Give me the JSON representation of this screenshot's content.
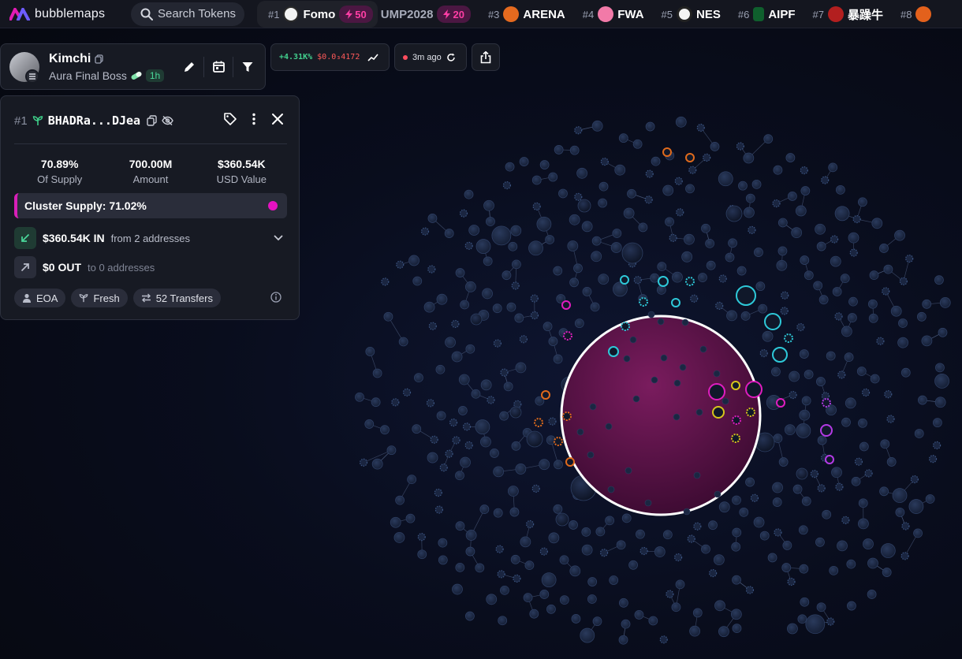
{
  "app": {
    "logo_text": "bubblemaps"
  },
  "search": {
    "label": "Search Tokens"
  },
  "trending": [
    {
      "rank": "#1",
      "name": "Fomo",
      "boost": "50"
    },
    {
      "rank": "",
      "name": "UMP2028",
      "boost": "20"
    },
    {
      "rank": "#3",
      "name": "ARENA"
    },
    {
      "rank": "#4",
      "name": "FWA"
    },
    {
      "rank": "#5",
      "name": "NES"
    },
    {
      "rank": "#6",
      "name": "AIPF"
    },
    {
      "rank": "#7",
      "name": "暴躁牛"
    },
    {
      "rank": "#8",
      "name": ""
    }
  ],
  "user": {
    "name": "Kimchi",
    "title": "Aura Final Boss",
    "age": "1h"
  },
  "price_pill": {
    "change": "+4.31K%",
    "price": "$0.0₃4172"
  },
  "time_pill": {
    "label": "3m ago"
  },
  "detail": {
    "rank": "#1",
    "address": "BHADRa...DJea",
    "stats": [
      {
        "value": "70.89%",
        "label": "Of Supply"
      },
      {
        "value": "700.00M",
        "label": "Amount"
      },
      {
        "value": "$360.54K",
        "label": "USD Value"
      }
    ],
    "cluster": "Cluster Supply: 71.02%",
    "inflow": {
      "amount": "$360.54K IN",
      "sub": "from 2 addresses"
    },
    "outflow": {
      "amount": "$0 OUT",
      "sub": "to 0 addresses"
    },
    "chips": [
      "EOA",
      "Fresh",
      "52 Transfers"
    ]
  },
  "colors": {
    "accent": "#e612c2",
    "cluster_bubble": "#6e1652",
    "cyan": "#2ec9d9",
    "magenta": "#e01dc0",
    "yellow": "#d6c51c",
    "orange": "#e06a1c",
    "purple": "#b43ae6",
    "node": "#1b2a48"
  }
}
